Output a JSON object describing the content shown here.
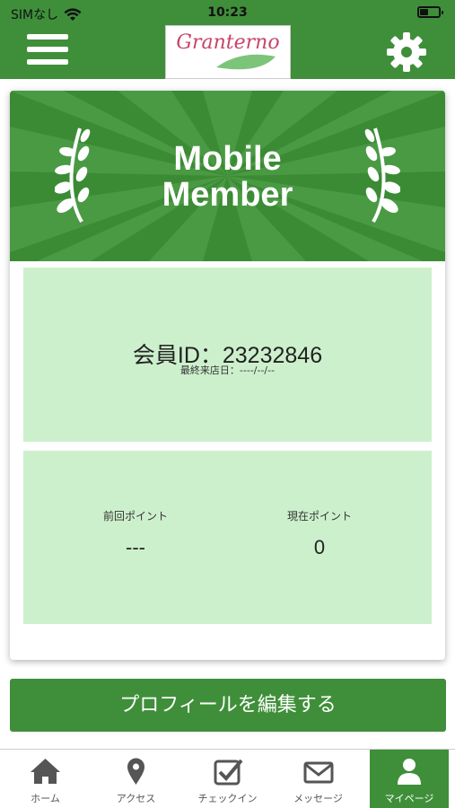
{
  "status_bar": {
    "carrier": "SIMなし",
    "time": "10:23"
  },
  "header": {
    "logo_text": "Granterno",
    "menu_icon": "hamburger-menu-icon",
    "settings_icon": "gear-icon"
  },
  "member_card": {
    "title_line1": "Mobile",
    "title_line2": "Member",
    "member_id": "会員ID：23232846",
    "last_visit": "最終来店日：----/--/--",
    "previous_points_label": "前回ポイント",
    "previous_points_value": "---",
    "current_points_label": "現在ポイント",
    "current_points_value": "0"
  },
  "edit_profile_button": "プロフィールを編集する",
  "tabs": [
    {
      "label": "ホーム",
      "icon": "home-icon",
      "active": false
    },
    {
      "label": "アクセス",
      "icon": "map-pin-icon",
      "active": false
    },
    {
      "label": "チェックイン",
      "icon": "checkbox-icon",
      "active": false
    },
    {
      "label": "メッセージ",
      "icon": "envelope-icon",
      "active": false
    },
    {
      "label": "マイページ",
      "icon": "user-icon",
      "active": true
    }
  ],
  "colors": {
    "brand_green": "#3f8f3a",
    "panel_green": "#cdf0cc",
    "logo_pink": "#c7446a"
  }
}
